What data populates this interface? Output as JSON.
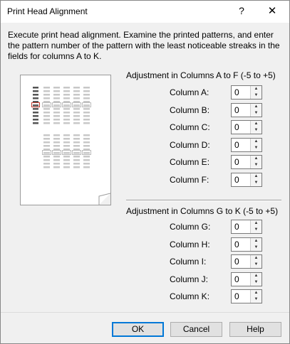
{
  "window": {
    "title": "Print Head Alignment",
    "help_glyph": "?",
    "close_glyph": "✕"
  },
  "instructions": "Execute print head alignment. Examine the printed patterns, and enter the pattern number of the pattern with the least noticeable streaks in the fields for columns A to K.",
  "group_af": {
    "title": "Adjustment in Columns A to F (-5 to +5)",
    "rows": [
      {
        "label": "Column A:",
        "value": "0"
      },
      {
        "label": "Column B:",
        "value": "0"
      },
      {
        "label": "Column C:",
        "value": "0"
      },
      {
        "label": "Column D:",
        "value": "0"
      },
      {
        "label": "Column E:",
        "value": "0"
      },
      {
        "label": "Column F:",
        "value": "0"
      }
    ]
  },
  "group_gk": {
    "title": "Adjustment in Columns G to K (-5 to +5)",
    "rows": [
      {
        "label": "Column G:",
        "value": "0"
      },
      {
        "label": "Column H:",
        "value": "0"
      },
      {
        "label": "Column I:",
        "value": "0"
      },
      {
        "label": "Column J:",
        "value": "0"
      },
      {
        "label": "Column K:",
        "value": "0"
      }
    ]
  },
  "buttons": {
    "ok": "OK",
    "cancel": "Cancel",
    "help": "Help"
  },
  "colors": {
    "accent": "#0078d7",
    "highlight_marker": "#c0392b",
    "pattern_dark": "#555555",
    "pattern_light": "#c8c8c8"
  }
}
